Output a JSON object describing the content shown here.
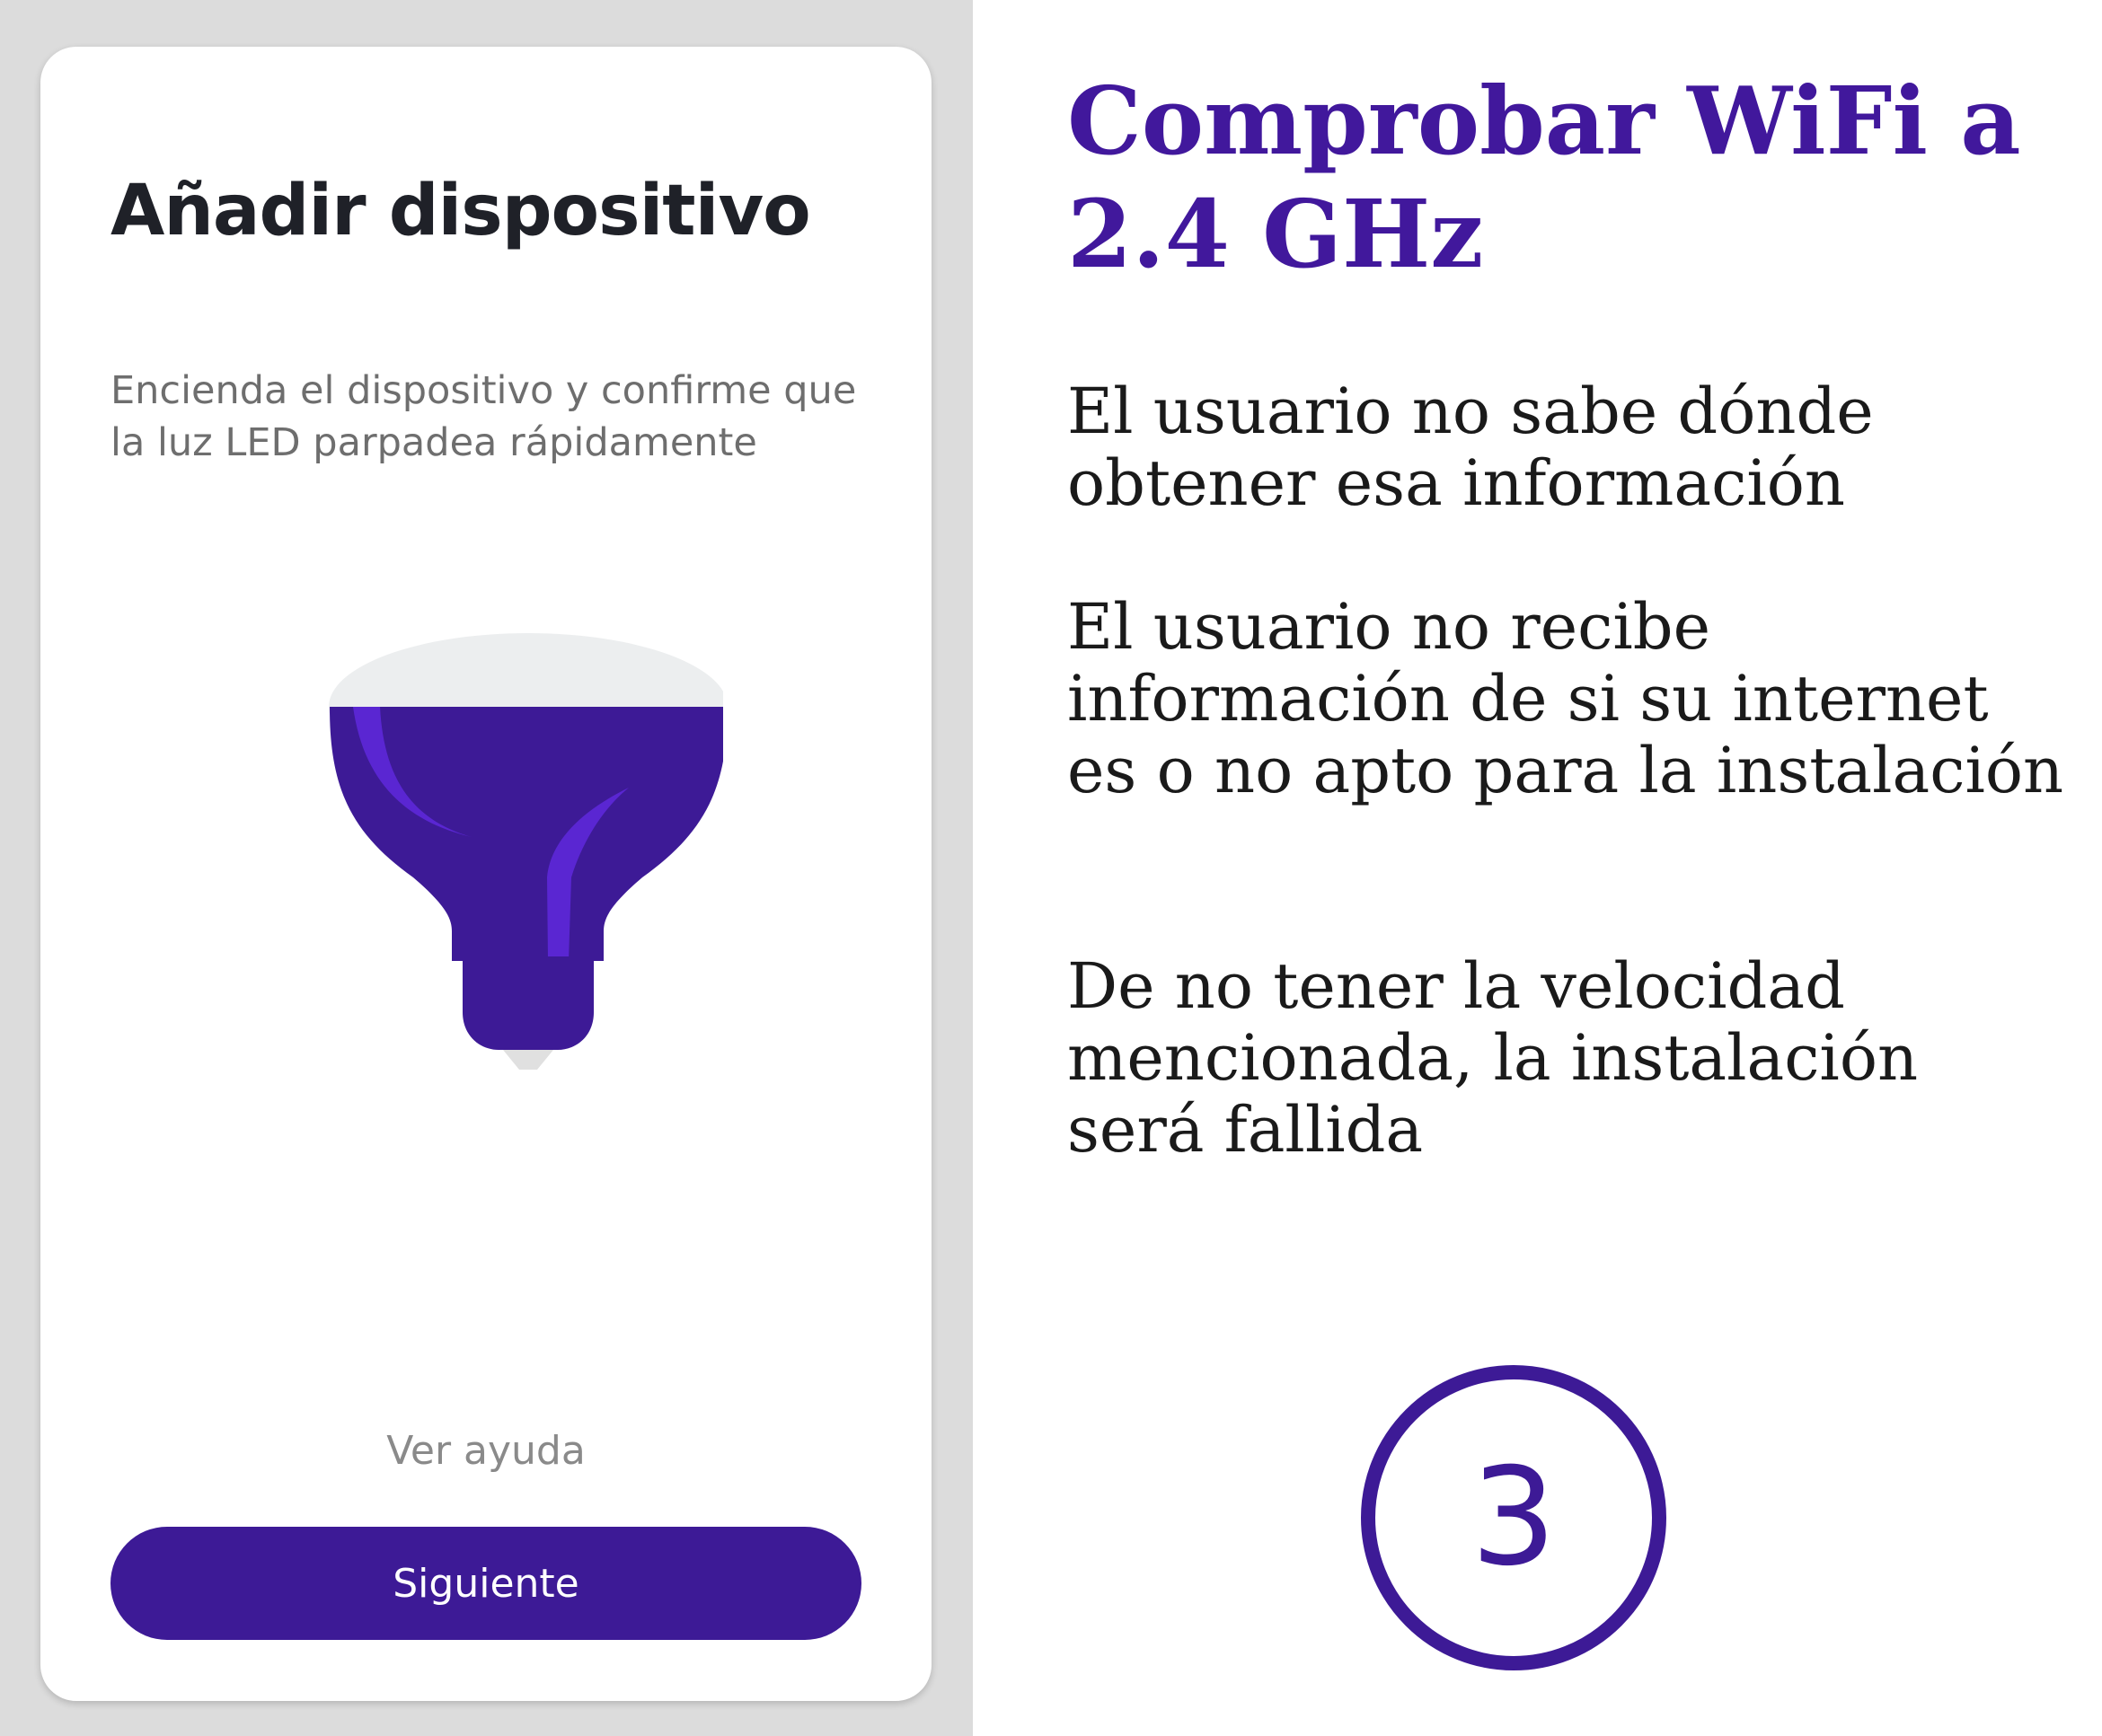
{
  "app_screen": {
    "title": "Añadir dispositivo",
    "description": "Encienda el dispositivo y confirme que la luz LED parpadea rápidamente",
    "illustration_icon": "light-bulb-icon",
    "help_link": "Ver ayuda",
    "next_button": "Siguiente"
  },
  "annotation": {
    "heading": "Comprobar WiFi a 2.4 GHz",
    "issues": [
      "El usuario no sabe dónde obtener esa información",
      "El usuario no recibe información de si su internet es o no apto para la instalación",
      "De no tener la velocidad mencionada, la instalación será fallida"
    ],
    "step_number": "3"
  },
  "colors": {
    "accent": "#3d1a96",
    "heading": "#41189c",
    "bulb_highlight": "#5a26d2",
    "bulb_cap": "#eceeef",
    "left_background": "#dcdcdc"
  }
}
